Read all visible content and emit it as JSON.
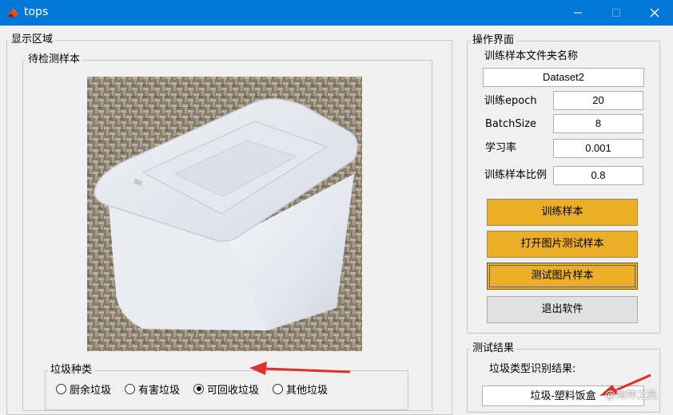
{
  "window": {
    "title": "tops"
  },
  "display_area": {
    "legend": "显示区域",
    "sample_legend": "待检测样本",
    "category_legend": "垃圾种类",
    "categories": [
      {
        "label": "厨余垃圾",
        "checked": false
      },
      {
        "label": "有害垃圾",
        "checked": false
      },
      {
        "label": "可回收垃圾",
        "checked": true
      },
      {
        "label": "其他垃圾",
        "checked": false
      }
    ]
  },
  "operation_panel": {
    "legend": "操作界面",
    "folder_label": "训练样本文件夹名称",
    "folder_value": "Dataset2",
    "epoch_label": "训练epoch",
    "epoch_value": "20",
    "batch_label": "BatchSize",
    "batch_value": "8",
    "lr_label": "学习率",
    "lr_value": "0.001",
    "ratio_label": "训练样本比例",
    "ratio_value": "0.8",
    "buttons": {
      "train": "训练样本",
      "open_image": "打开图片测试样本",
      "test_image": "测试图片样本",
      "exit": "退出软件"
    }
  },
  "test_result": {
    "legend": "测试结果",
    "label": "垃圾类型识别结果:",
    "value": "垃圾-塑料饭盒"
  },
  "watermark": "@海神之光",
  "colors": {
    "titlebar": "#0078d7",
    "button_accent": "#eaae27",
    "arrow": "#e0302a"
  }
}
